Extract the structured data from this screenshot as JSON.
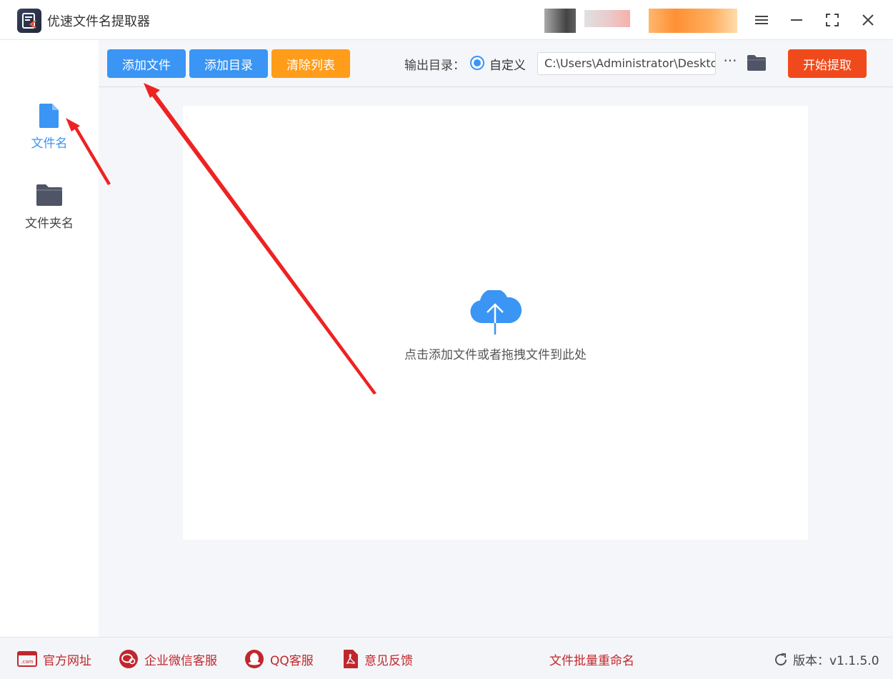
{
  "app": {
    "title": "优速文件名提取器"
  },
  "sidebar": {
    "items": [
      {
        "label": "文件名",
        "active": true,
        "icon": "file-icon"
      },
      {
        "label": "文件夹名",
        "active": false,
        "icon": "folder-icon"
      }
    ]
  },
  "toolbar": {
    "add_file": "添加文件",
    "add_dir": "添加目录",
    "clear_list": "清除列表",
    "output_label": "输出目录：",
    "custom_label": "自定义",
    "output_path": "C:\\Users\\Administrator\\Desktop",
    "more": "···",
    "start": "开始提取"
  },
  "dropzone": {
    "text": "点击添加文件或者拖拽文件到此处"
  },
  "footer": {
    "website": "官方网址",
    "wechat": "企业微信客服",
    "qq": "QQ客服",
    "feedback": "意见反馈",
    "center_link": "文件批量重命名",
    "version": "版本：v1.1.5.0"
  },
  "colors": {
    "accent_blue": "#3a95f4",
    "accent_orange": "#ff9c19",
    "accent_red": "#f04a1c",
    "footer_red": "#c0272d",
    "arrow_red": "#ee2222"
  }
}
